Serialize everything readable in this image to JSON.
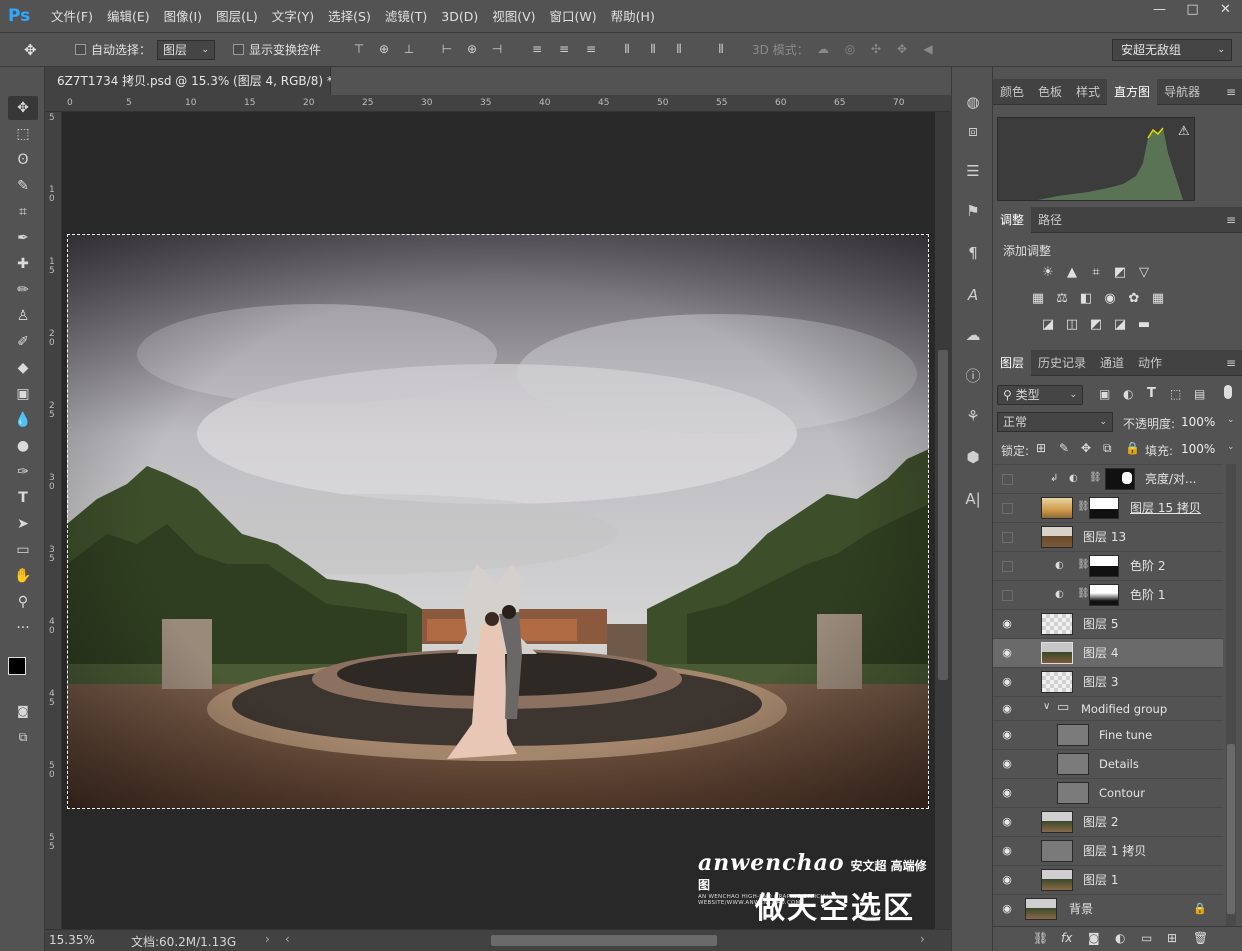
{
  "app": {
    "logo": "Ps"
  },
  "menu": [
    "文件(F)",
    "编辑(E)",
    "图像(I)",
    "图层(L)",
    "文字(Y)",
    "选择(S)",
    "滤镜(T)",
    "3D(D)",
    "视图(V)",
    "窗口(W)",
    "帮助(H)"
  ],
  "window_controls": {
    "minimize": "—",
    "maximize": "□",
    "close": "✕"
  },
  "options": {
    "auto_select_label": "自动选择：",
    "auto_select_value": "图层",
    "show_transform_label": "显示变换控件",
    "mode_3d_label": "3D 模式：",
    "workspace": "安超无敌组"
  },
  "document": {
    "tab_title": "6Z7T1734 拷贝.psd @ 15.3% (图层 4, RGB/8) *",
    "close_glyph": "×",
    "ruler_h": [
      "0",
      "5",
      "10",
      "15",
      "20",
      "25",
      "30",
      "35",
      "40",
      "45",
      "50",
      "55",
      "60",
      "65",
      "70"
    ],
    "ruler_v": [
      "5",
      "1 0",
      "1 5",
      "2 0",
      "2 5",
      "3 0",
      "3 5",
      "4 0",
      "4 5",
      "5 0",
      "5 5"
    ],
    "zoom": "15.35%",
    "doc_size": "文档:60.2M/1.13G",
    "watermark_brand": "anwenchao",
    "watermark_cn": "安文超 高端修图",
    "watermark_sub": "AN WENCHAO HIGH-END GRAPHIC OFFICIAL WEBSITE/WWW.ANWENCHAO.COM",
    "caption": "做天空选区"
  },
  "panels": {
    "top_tabs": [
      "颜色",
      "色板",
      "样式",
      "直方图",
      "导航器"
    ],
    "top_active": "直方图",
    "adj_tabs": [
      "调整",
      "路径"
    ],
    "adj_active": "调整",
    "adj_title": "添加调整",
    "layer_tabs": [
      "图层",
      "历史记录",
      "通道",
      "动作"
    ],
    "layer_active": "图层",
    "filter_kind": "类型",
    "blend_mode": "正常",
    "opacity_label": "不透明度:",
    "opacity_value": "100%",
    "lock_label": "锁定:",
    "fill_label": "填充:",
    "fill_value": "100%"
  },
  "layers": [
    {
      "name": "亮度/对...",
      "visible": false,
      "kind": "adj"
    },
    {
      "name": "图层 15 拷贝",
      "visible": false,
      "kind": "photo-mask"
    },
    {
      "name": "图层 13",
      "visible": false,
      "kind": "photo"
    },
    {
      "name": "色阶 2",
      "visible": false,
      "kind": "levels"
    },
    {
      "name": "色阶 1",
      "visible": false,
      "kind": "levels"
    },
    {
      "name": "图层 5",
      "visible": true,
      "kind": "trans"
    },
    {
      "name": "图层 4",
      "visible": true,
      "kind": "photo",
      "selected": true
    },
    {
      "name": "图层 3",
      "visible": true,
      "kind": "trans"
    },
    {
      "name": "Modified group",
      "visible": true,
      "kind": "group"
    },
    {
      "name": "Fine tune",
      "visible": true,
      "kind": "gray"
    },
    {
      "name": "Details",
      "visible": true,
      "kind": "gray"
    },
    {
      "name": "Contour",
      "visible": true,
      "kind": "gray"
    },
    {
      "name": "图层 2",
      "visible": true,
      "kind": "photo"
    },
    {
      "name": "图层 1 拷贝",
      "visible": true,
      "kind": "gray"
    },
    {
      "name": "图层 1",
      "visible": true,
      "kind": "photo"
    },
    {
      "name": "背景",
      "visible": true,
      "kind": "photo",
      "locked": true
    }
  ],
  "colors": {
    "accent": "#31a8ff",
    "panel": "#535353",
    "dark": "#424242"
  }
}
